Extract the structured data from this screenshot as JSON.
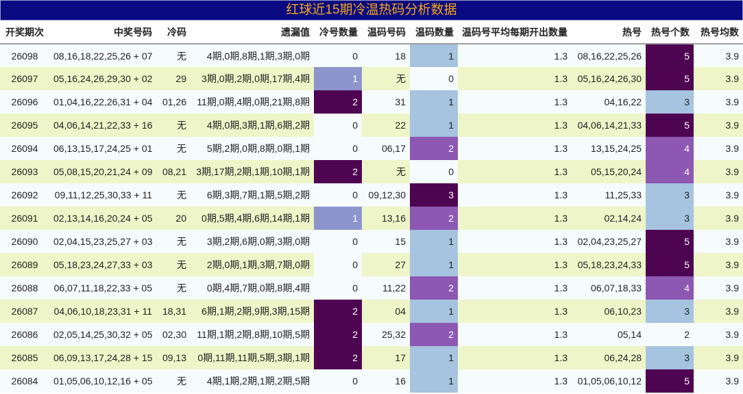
{
  "title": "红球近15期冷温热码分析数据",
  "columns": [
    "开奖期次",
    "中奖号码",
    "冷码",
    "遗漏值",
    "冷号数量",
    "温码号码",
    "温码数量",
    "温码号平均每期开出数量",
    "热号",
    "热号个数",
    "热号均数"
  ],
  "rows": [
    {
      "issue": "26098",
      "numbers": "08,16,18,22,25,26 + 07",
      "cold": "无",
      "omission": "4期,0期,8期,1期,3期,0期",
      "cold_count": "0",
      "warm": "18",
      "warm_count": "1",
      "warm_avg": "1.3",
      "hot": "08,16,22,25,26",
      "hot_count": "5",
      "hot_avg": "3.9"
    },
    {
      "issue": "26097",
      "numbers": "05,16,24,26,29,30 + 02",
      "cold": "29",
      "omission": "3期,0期,2期,0期,17期,4期",
      "cold_count": "1",
      "warm": "无",
      "warm_count": "0",
      "warm_avg": "1.3",
      "hot": "05,16,24,26,30",
      "hot_count": "5",
      "hot_avg": "3.9"
    },
    {
      "issue": "26096",
      "numbers": "01,04,16,22,26,31 + 04",
      "cold": "01,26",
      "omission": "11期,0期,4期,0期,21期,8期",
      "cold_count": "2",
      "warm": "31",
      "warm_count": "1",
      "warm_avg": "1.3",
      "hot": "04,16,22",
      "hot_count": "3",
      "hot_avg": "3.9"
    },
    {
      "issue": "26095",
      "numbers": "04,06,14,21,22,33 + 16",
      "cold": "无",
      "omission": "4期,0期,3期,1期,6期,2期",
      "cold_count": "0",
      "warm": "22",
      "warm_count": "1",
      "warm_avg": "1.3",
      "hot": "04,06,14,21,33",
      "hot_count": "5",
      "hot_avg": "3.9"
    },
    {
      "issue": "26094",
      "numbers": "06,13,15,17,24,25 + 01",
      "cold": "无",
      "omission": "5期,2期,0期,8期,0期,1期",
      "cold_count": "0",
      "warm": "06,17",
      "warm_count": "2",
      "warm_avg": "1.3",
      "hot": "13,15,24,25",
      "hot_count": "4",
      "hot_avg": "3.9"
    },
    {
      "issue": "26093",
      "numbers": "05,08,15,20,21,24 + 09",
      "cold": "08,21",
      "omission": "3期,17期,2期,1期,10期,1期",
      "cold_count": "2",
      "warm": "无",
      "warm_count": "0",
      "warm_avg": "1.3",
      "hot": "05,15,20,24",
      "hot_count": "4",
      "hot_avg": "3.9"
    },
    {
      "issue": "26092",
      "numbers": "09,11,12,25,30,33 + 11",
      "cold": "无",
      "omission": "6期,3期,7期,1期,5期,2期",
      "cold_count": "0",
      "warm": "09,12,30",
      "warm_count": "3",
      "warm_avg": "1.3",
      "hot": "11,25,33",
      "hot_count": "3",
      "hot_avg": "3.9"
    },
    {
      "issue": "26091",
      "numbers": "02,13,14,16,20,24 + 05",
      "cold": "20",
      "omission": "0期,5期,4期,6期,14期,1期",
      "cold_count": "1",
      "warm": "13,16",
      "warm_count": "2",
      "warm_avg": "1.3",
      "hot": "02,14,24",
      "hot_count": "3",
      "hot_avg": "3.9"
    },
    {
      "issue": "26090",
      "numbers": "02,04,15,23,25,27 + 03",
      "cold": "无",
      "omission": "3期,2期,6期,0期,3期,0期",
      "cold_count": "0",
      "warm": "15",
      "warm_count": "1",
      "warm_avg": "1.3",
      "hot": "02,04,23,25,27",
      "hot_count": "5",
      "hot_avg": "3.9"
    },
    {
      "issue": "26089",
      "numbers": "05,18,23,24,27,33 + 03",
      "cold": "无",
      "omission": "2期,0期,1期,3期,7期,0期",
      "cold_count": "0",
      "warm": "27",
      "warm_count": "1",
      "warm_avg": "1.3",
      "hot": "05,18,23,24,33",
      "hot_count": "5",
      "hot_avg": "3.9"
    },
    {
      "issue": "26088",
      "numbers": "06,07,11,18,22,33 + 05",
      "cold": "无",
      "omission": "0期,4期,7期,0期,8期,4期",
      "cold_count": "0",
      "warm": "11,22",
      "warm_count": "2",
      "warm_avg": "1.3",
      "hot": "06,07,18,33",
      "hot_count": "4",
      "hot_avg": "3.9"
    },
    {
      "issue": "26087",
      "numbers": "04,06,10,18,23,31 + 11",
      "cold": "18,31",
      "omission": "6期,1期,2期,9期,3期,15期",
      "cold_count": "2",
      "warm": "04",
      "warm_count": "1",
      "warm_avg": "1.3",
      "hot": "06,10,23",
      "hot_count": "3",
      "hot_avg": "3.9"
    },
    {
      "issue": "26086",
      "numbers": "02,05,14,25,30,32 + 05",
      "cold": "02,30",
      "omission": "11期,1期,2期,8期,10期,5期",
      "cold_count": "2",
      "warm": "25,32",
      "warm_count": "2",
      "warm_avg": "1.3",
      "hot": "05,14",
      "hot_count": "2",
      "hot_avg": "3.9"
    },
    {
      "issue": "26085",
      "numbers": "06,09,13,17,24,28 + 15",
      "cold": "09,13",
      "omission": "0期,11期,11期,5期,3期,1期",
      "cold_count": "2",
      "warm": "17",
      "warm_count": "1",
      "warm_avg": "1.3",
      "hot": "06,24,28",
      "hot_count": "3",
      "hot_avg": "3.9"
    },
    {
      "issue": "26084",
      "numbers": "01,05,06,10,12,16 + 05",
      "cold": "无",
      "omission": "4期,1期,2期,1期,2期,5期",
      "cold_count": "0",
      "warm": "16",
      "warm_count": "1",
      "warm_avg": "1.3",
      "hot": "01,05,06,10,12",
      "hot_count": "5",
      "hot_avg": "3.9"
    }
  ]
}
